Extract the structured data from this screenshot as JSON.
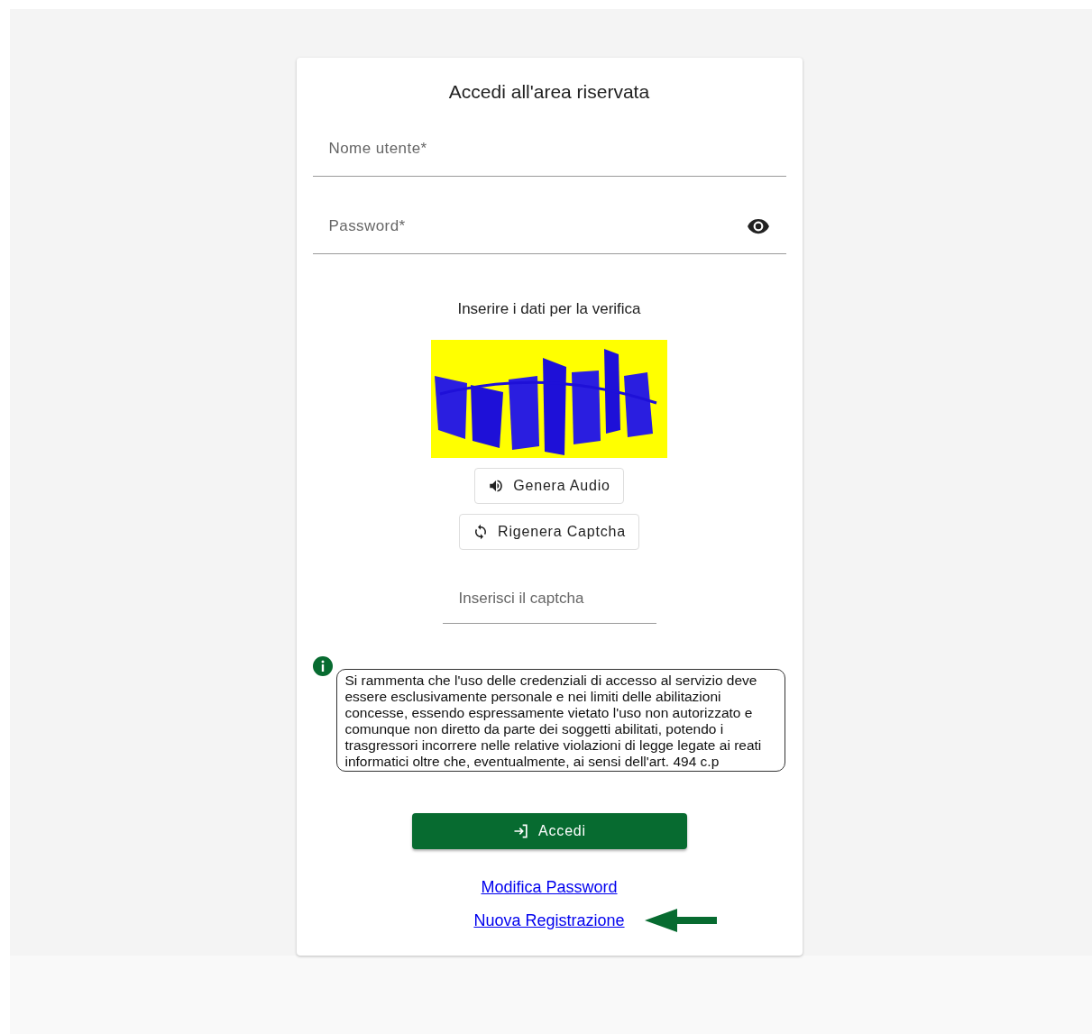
{
  "title": "Accedi all'area riservata",
  "fields": [
    {
      "kind": "text",
      "label": "Nome utente*"
    },
    {
      "kind": "password",
      "label": "Password*"
    }
  ],
  "captcha": {
    "heading": "Inserire i dati per la verifica",
    "buttons": [
      {
        "kind": "audio",
        "label": "Genera Audio"
      },
      {
        "kind": "refresh",
        "label": "Rigenera Captcha"
      }
    ],
    "input": {
      "placeholder": "Inserisci il captcha"
    }
  },
  "notice": "Si rammenta che l'uso delle credenziali di accesso al servizio deve essere esclusivamente personale e nei limiti delle abilitazioni concesse, essendo espressamente vietato l'uso non autorizzato e comunque non diretto da parte dei soggetti abilitati, potendo i trasgressori incorrere nelle relative violazioni di legge legate ai reati informatici oltre che, eventualmente, ai sensi dell'art. 494 c.p",
  "submit": {
    "label": "Accedi"
  },
  "links": [
    {
      "label": "Modifica Password",
      "pointer": false
    },
    {
      "label": "Nuova Registrazione",
      "pointer": true
    }
  ]
}
